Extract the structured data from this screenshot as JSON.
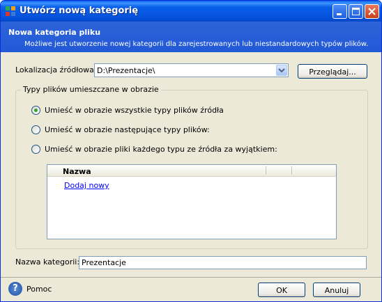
{
  "window": {
    "title": "Utwórz nową kategorię"
  },
  "header": {
    "title": "Nowa kategoria pliku",
    "description": "Możliwe jest utworzenie nowej kategorii dla zarejestrowanych lub niestandardowych typów plików."
  },
  "source": {
    "label": "Lokalizacja źródłowa:",
    "value": "D:\\Prezentacje\\",
    "browse_label": "Przeglądaj..."
  },
  "file_types": {
    "group_title": "Typy plików umieszczane w obrazie",
    "options": [
      {
        "label": "Umieść w obrazie wszystkie typy plików źródła",
        "selected": true
      },
      {
        "label": "Umieść w obrazie następujące typy plików:",
        "selected": false
      },
      {
        "label": "Umieść w obrazie pliki każdego typu ze źródła za wyjątkiem:",
        "selected": false
      }
    ],
    "list": {
      "column_name": "Nazwa",
      "add_link": "Dodaj nowy"
    }
  },
  "category_name": {
    "label": "Nazwa kategorii:",
    "value": "Prezentacje"
  },
  "footer": {
    "help_label": "Pomoc",
    "ok_label": "OK",
    "cancel_label": "Anuluj"
  }
}
